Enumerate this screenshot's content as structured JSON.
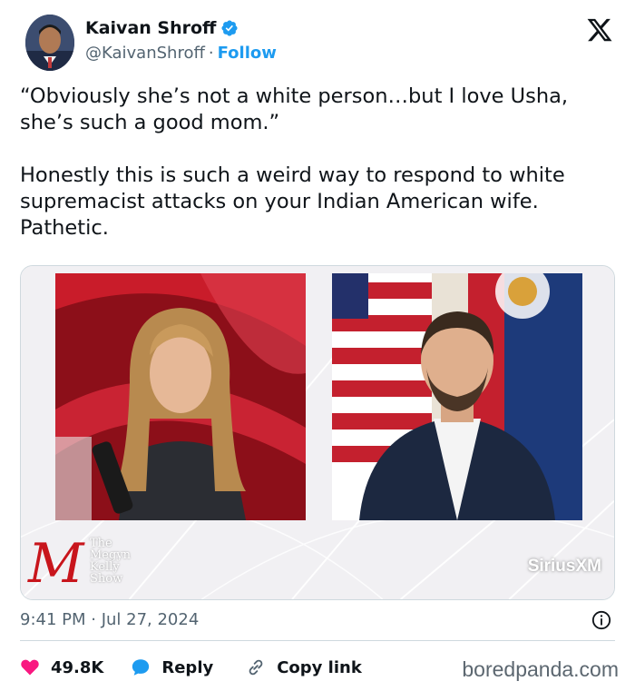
{
  "tweet": {
    "author_name": "Kaivan Shroff",
    "handle": "@KaivanShroff",
    "separator": "·",
    "follow_label": "Follow",
    "text_paragraphs": [
      "“Obviously she’s not a white person…but I love Usha, she’s such a good mom.”",
      "Honestly this is such a weird way to respond to white supremacist attacks on your Indian American wife. Pathetic."
    ],
    "time": "9:41 PM · Jul 27, 2024"
  },
  "media": {
    "show_logo_letter": "M",
    "show_logo_lines": [
      "The",
      "Megyn",
      "Kelly",
      "Show"
    ],
    "network_logo": "SiriusXM"
  },
  "actions": {
    "like_count": "49.8K",
    "reply_label": "Reply",
    "copy_label": "Copy link"
  },
  "icons": {
    "verified": "verified-badge-icon",
    "platform": "x-logo-icon",
    "info": "info-icon",
    "like": "heart-icon",
    "reply": "speech-bubble-icon",
    "copy": "link-icon"
  },
  "colors": {
    "accent": "#1d9bf0",
    "like": "#f91880",
    "text": "#0f1419",
    "muted": "#536471"
  },
  "watermark": "boredpanda.com"
}
